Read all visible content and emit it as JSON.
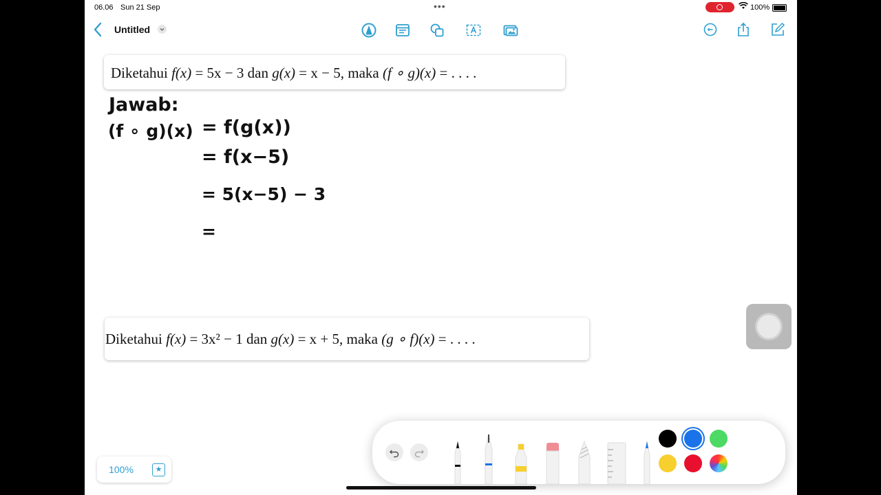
{
  "status_bar": {
    "time": "06.06",
    "date": "Sun 21 Sep",
    "battery": "100%"
  },
  "nav": {
    "title": "Untitled"
  },
  "problems": {
    "p1": {
      "pre": "Diketahui ",
      "f": "f(x)",
      "f_def": " = 5x − 3 dan ",
      "g": "g(x)",
      "g_def": " = x − 5, maka ",
      "comp": "(f ∘ g)(x)",
      "tail": " = . . . ."
    },
    "p2": {
      "pre": "Diketahui ",
      "f": "f(x)",
      "f_def": " = 3x² − 1 dan ",
      "g": "g(x)",
      "g_def": " = x + 5, maka ",
      "comp": "(g ∘ f)(x)",
      "tail": " = . . . ."
    }
  },
  "handwriting": {
    "label": "Jawab:",
    "lhs": "(f ∘ g)(x)",
    "line1": "= f(g(x))",
    "line2": "= f(x−5)",
    "line3": "= 5(x−5) − 3",
    "line4": "="
  },
  "zoom": {
    "level": "100%"
  },
  "palette": {
    "colors": [
      "#000000",
      "#1a73e8",
      "#4cd964",
      "#f7cf2e",
      "#e8102e"
    ]
  }
}
